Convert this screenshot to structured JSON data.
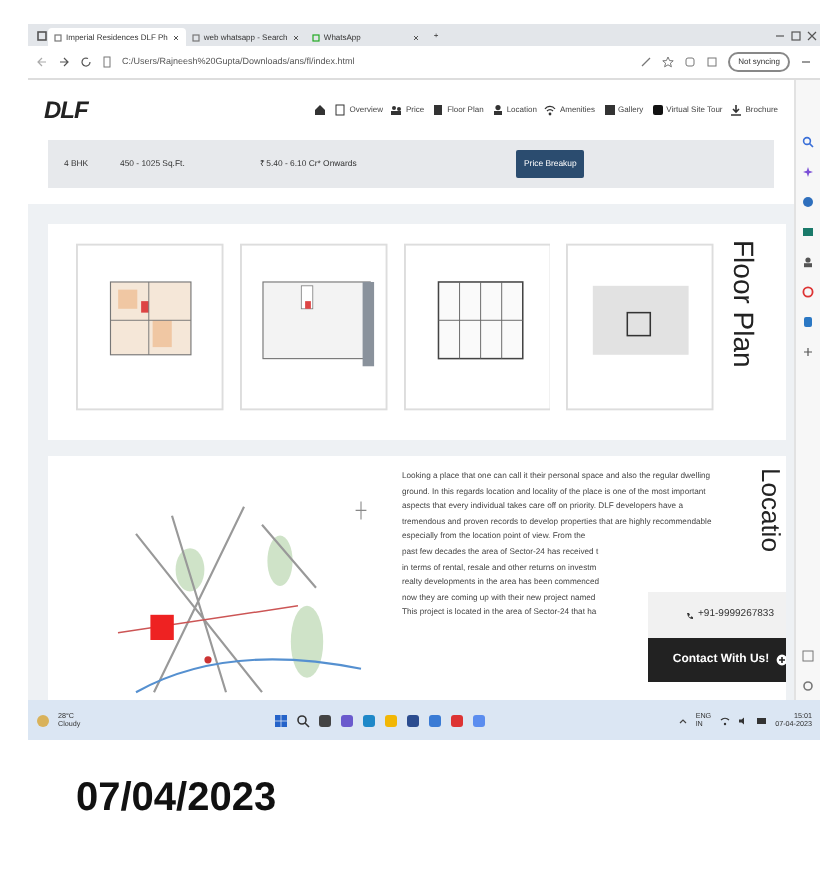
{
  "browser": {
    "tabs": [
      {
        "title": "Imperial Residences DLF Ph",
        "selected": true
      },
      {
        "title": "web whatsapp - Search",
        "selected": false
      },
      {
        "title": "WhatsApp",
        "selected": false
      }
    ],
    "new_tab": "+",
    "address": "C:/Users/Rajneesh%20Gupta/Downloads/ans/fl/index.html",
    "profile": "Not syncing"
  },
  "site": {
    "logo": "DLF",
    "nav": [
      "Overview",
      "Price",
      "Floor Plan",
      "Location",
      "Amenities",
      "Gallery",
      "Virtual Site Tour",
      "Brochure"
    ]
  },
  "price_row": {
    "type": "4 BHK",
    "area": "450 - 1025 Sq.Ft.",
    "price": "₹ 5.40 - 6.10 Cr* Onwards",
    "button": "Price Breakup"
  },
  "floor_plan": {
    "heading": "Floor Plan",
    "plans": [
      {
        "kind": "colored"
      },
      {
        "kind": "open"
      },
      {
        "kind": "grid"
      },
      {
        "kind": "simple"
      }
    ]
  },
  "location": {
    "heading": "Locatio",
    "paragraph": "Looking a place that one can call it their personal space and also the regular dwelling ground. In this regards location and locality of the place is one of the most important aspects that every individual takes care off on priority. DLF developers have a tremendous and proven records to develop properties that are highly recommendable especially from the location point of view. From the",
    "cut_lines": [
      "past few decades the area of Sector-24 has received t",
      "in terms of rental, resale and other returns on investm",
      "realty developments in the area has been commenced",
      "now they are coming up with their new project named",
      "This project is located in the area of Sector-24 that ha"
    ]
  },
  "contact": {
    "phone": "+91-9999267833",
    "button": "Contact With Us!"
  },
  "taskbar": {
    "temp": "28°C",
    "weather": "Cloudy",
    "lang": "ENG",
    "region": "IN",
    "time": "15:01",
    "date": "07-04-2023"
  },
  "caption": "07/04/2023"
}
